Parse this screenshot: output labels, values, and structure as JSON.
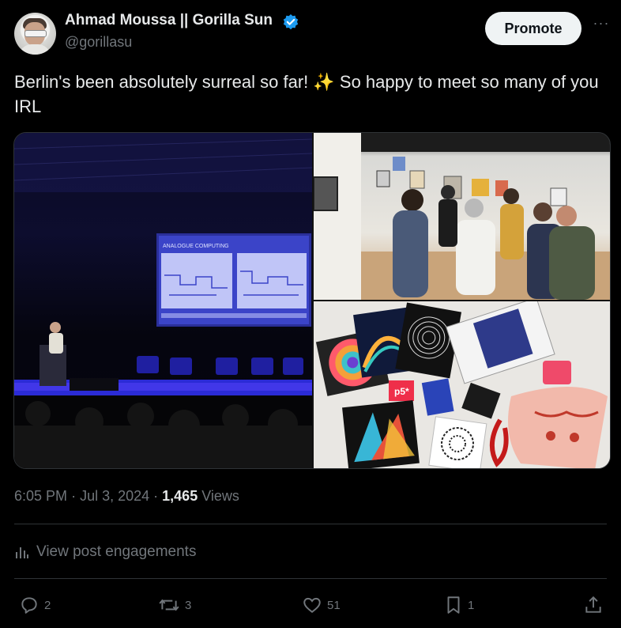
{
  "author": {
    "name": "Ahmad Moussa || Gorilla Sun",
    "handle": "@gorillasu"
  },
  "header": {
    "promote_label": "Promote",
    "more_label": "···"
  },
  "tweet": {
    "text": "Berlin's been absolutely surreal so far! ✨ So happy to meet so many of you IRL"
  },
  "media": {
    "slide_title": "ANALOGUE COMPUTING",
    "sticker_text": "p5*"
  },
  "meta": {
    "time": "6:05 PM",
    "date": "Jul 3, 2024",
    "views_count": "1,465",
    "views_label": "Views"
  },
  "engagements": {
    "label": "View post engagements"
  },
  "actions": {
    "replies": "2",
    "reposts": "3",
    "likes": "51",
    "bookmarks": "1"
  },
  "colors": {
    "background": "#000000",
    "verified": "#1d9bf0",
    "muted": "#71767b",
    "text": "#e7e9ea"
  }
}
